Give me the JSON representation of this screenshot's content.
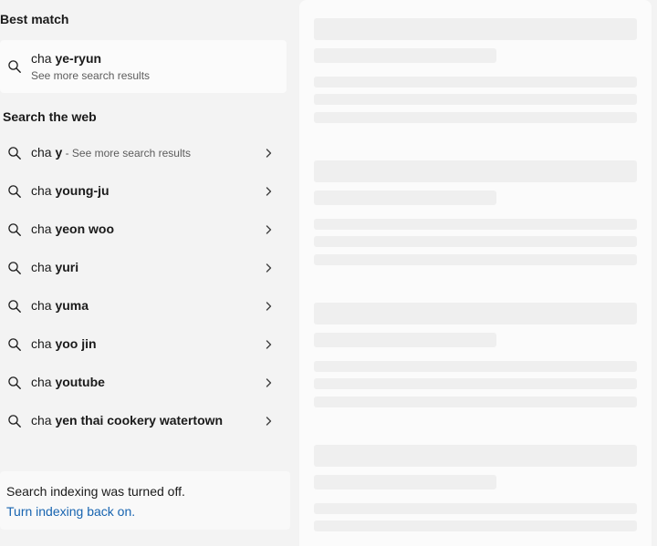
{
  "best_match": {
    "heading": "Best match",
    "query_prefix": "cha ",
    "query_bold": "ye-ryun",
    "subtitle": "See more search results"
  },
  "search_web": {
    "heading": "Search the web",
    "items": [
      {
        "prefix": "cha ",
        "bold": "y",
        "hint": " - See more search results"
      },
      {
        "prefix": "cha ",
        "bold": "young-ju",
        "hint": ""
      },
      {
        "prefix": "cha ",
        "bold": "yeon woo",
        "hint": ""
      },
      {
        "prefix": "cha ",
        "bold": "yuri",
        "hint": ""
      },
      {
        "prefix": "cha ",
        "bold": "yuma",
        "hint": ""
      },
      {
        "prefix": "cha ",
        "bold": "yoo jin",
        "hint": ""
      },
      {
        "prefix": "cha ",
        "bold": "youtube",
        "hint": ""
      },
      {
        "prefix": "cha ",
        "bold": "yen thai cookery watertown",
        "hint": ""
      }
    ]
  },
  "indexing": {
    "message": "Search indexing was turned off.",
    "link": "Turn indexing back on."
  },
  "icons": {
    "search": "search-icon",
    "chevron": "chevron-right-icon"
  },
  "colors": {
    "link": "#1764b0",
    "panel_bg": "#f3f3f3",
    "preview_bg": "#fbfbfb",
    "skeleton": "#efefef"
  }
}
